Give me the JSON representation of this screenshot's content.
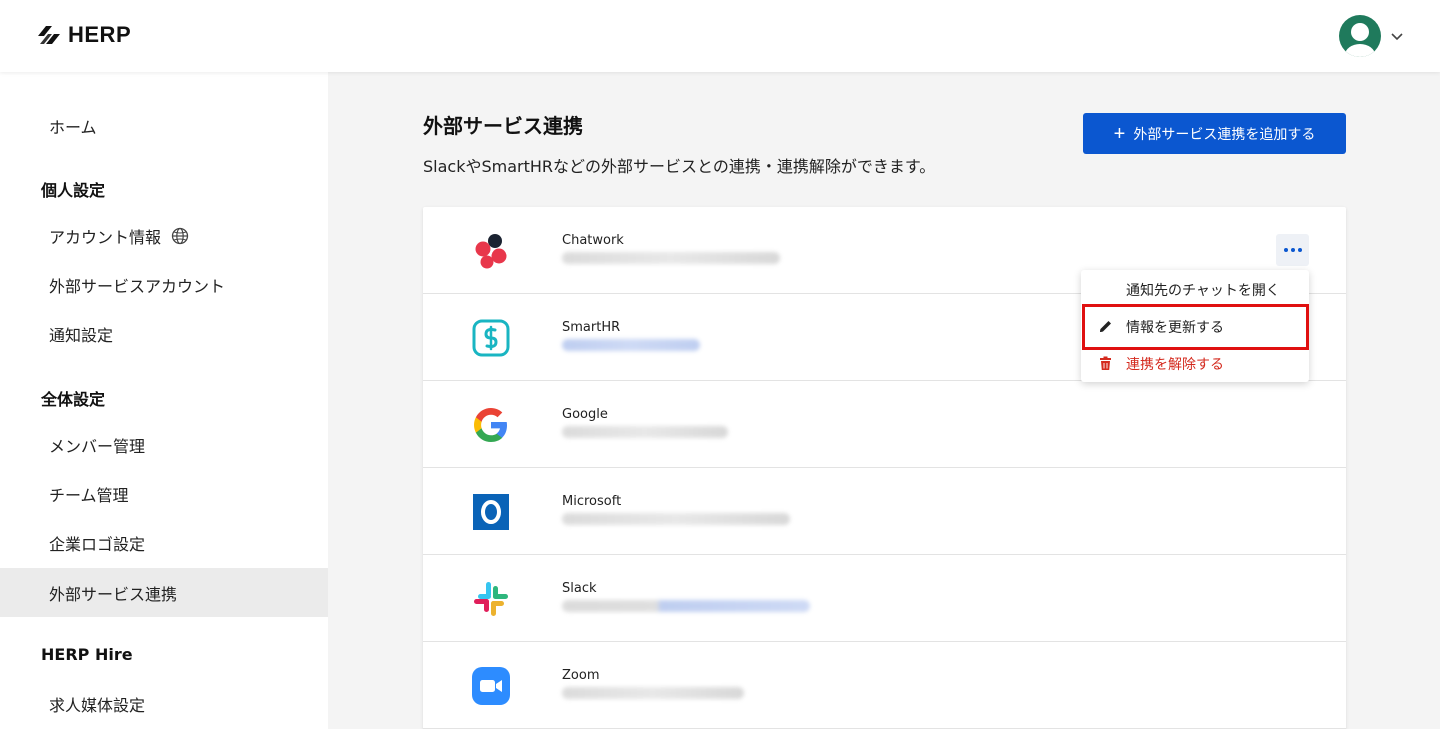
{
  "app": {
    "logo_text": "HERP"
  },
  "sidebar": {
    "items": [
      {
        "label": "ホーム"
      },
      {
        "heading": "個人設定"
      },
      {
        "label": "アカウント情報"
      },
      {
        "label": "外部サービスアカウント"
      },
      {
        "label": "通知設定"
      },
      {
        "heading": "全体設定"
      },
      {
        "label": "メンバー管理"
      },
      {
        "label": "チーム管理"
      },
      {
        "label": "企業ロゴ設定"
      },
      {
        "label": "外部サービス連携"
      },
      {
        "heading": "HERP Hire"
      },
      {
        "label": "求人媒体設定"
      }
    ]
  },
  "main": {
    "title": "外部サービス連携",
    "description": "SlackやSmartHRなどの外部サービスとの連携・連携解除ができます。",
    "add_button": "外部サービス連携を追加する",
    "services": [
      {
        "name": "Chatwork",
        "logo": "chatwork-logo"
      },
      {
        "name": "SmartHR",
        "logo": "smarthr-logo"
      },
      {
        "name": "Google",
        "logo": "google-logo"
      },
      {
        "name": "Microsoft",
        "logo": "outlook-logo"
      },
      {
        "name": "Slack",
        "logo": "slack-logo"
      },
      {
        "name": "Zoom",
        "logo": "zoom-logo"
      }
    ]
  },
  "menu": {
    "items": [
      {
        "label": "通知先のチャットを開く"
      },
      {
        "label": "情報を更新する",
        "icon": "pencil-icon"
      },
      {
        "label": "連携を解除する",
        "icon": "trash-icon"
      }
    ]
  },
  "colors": {
    "primary": "#0b57d0",
    "danger": "#d42a1e",
    "highlight": "#e01010"
  }
}
